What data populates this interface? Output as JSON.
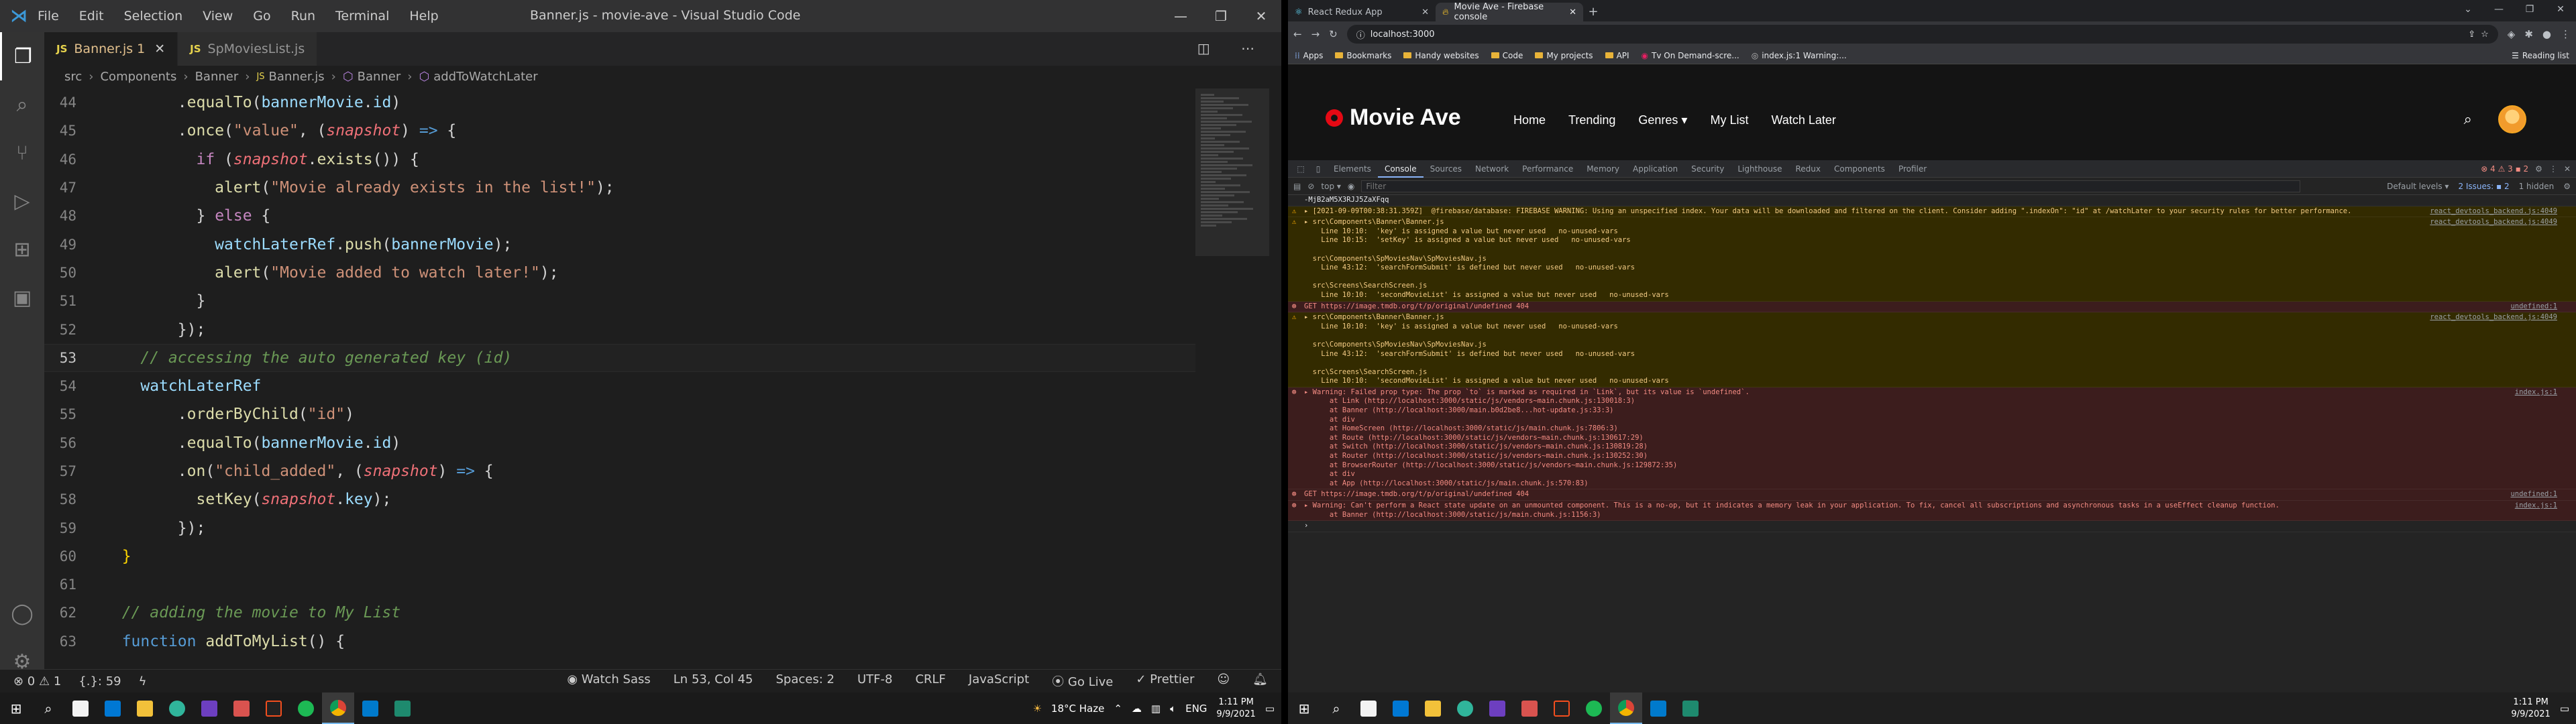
{
  "vscode": {
    "window_title": "Banner.js - movie-ave - Visual Studio Code",
    "menu": [
      "File",
      "Edit",
      "Selection",
      "View",
      "Go",
      "Run",
      "Terminal",
      "Help"
    ],
    "tabs": [
      {
        "label": "Banner.js",
        "badge": "1",
        "active": true
      },
      {
        "label": "SpMoviesList.js",
        "badge": "",
        "active": false
      }
    ],
    "breadcrumb": [
      "src",
      "Components",
      "Banner",
      "Banner.js",
      "Banner",
      "addToWatchLater"
    ],
    "code_lines": [
      {
        "n": "44",
        "html": "        <span class='tok-p'>.</span><span class='tok-fn'>equalTo</span><span class='tok-p'>(</span><span class='tok-var'>bannerMovie</span><span class='tok-p'>.</span><span class='tok-var'>id</span><span class='tok-p'>)</span>"
      },
      {
        "n": "45",
        "html": "        <span class='tok-p'>.</span><span class='tok-fn'>once</span><span class='tok-p'>(</span><span class='tok-str'>\"value\"</span><span class='tok-p'>, (</span><span class='tok-param'>snapshot</span><span class='tok-p'>) </span><span class='tok-blue'>=&gt;</span><span class='tok-p'> {</span>"
      },
      {
        "n": "46",
        "html": "          <span class='tok-kw'>if</span><span class='tok-p'> (</span><span class='tok-param'>snapshot</span><span class='tok-p'>.</span><span class='tok-fn'>exists</span><span class='tok-p'>()) {</span>"
      },
      {
        "n": "47",
        "html": "            <span class='tok-fn'>alert</span><span class='tok-p'>(</span><span class='tok-str'>\"Movie already exists in the list!\"</span><span class='tok-p'>);</span>"
      },
      {
        "n": "48",
        "html": "          <span class='tok-p'>} </span><span class='tok-kw'>else</span><span class='tok-p'> {</span>"
      },
      {
        "n": "49",
        "html": "            <span class='tok-var'>watchLaterRef</span><span class='tok-p'>.</span><span class='tok-fn'>push</span><span class='tok-p'>(</span><span class='tok-var'>bannerMovie</span><span class='tok-p'>);</span>"
      },
      {
        "n": "50",
        "html": "            <span class='tok-fn'>alert</span><span class='tok-p'>(</span><span class='tok-str'>\"Movie added to watch later!\"</span><span class='tok-p'>);</span>"
      },
      {
        "n": "51",
        "html": "          <span class='tok-p'>}</span>"
      },
      {
        "n": "52",
        "html": "        <span class='tok-p'>});</span>"
      },
      {
        "n": "53",
        "html": "    <span class='tok-cm'>// accessing the auto generated key (id)</span>",
        "current": true
      },
      {
        "n": "54",
        "html": "    <span class='tok-var'>watchLaterRef</span>"
      },
      {
        "n": "55",
        "html": "        <span class='tok-p'>.</span><span class='tok-fn'>orderByChild</span><span class='tok-p'>(</span><span class='tok-str'>\"id\"</span><span class='tok-p'>)</span>"
      },
      {
        "n": "56",
        "html": "        <span class='tok-p'>.</span><span class='tok-fn'>equalTo</span><span class='tok-p'>(</span><span class='tok-var'>bannerMovie</span><span class='tok-p'>.</span><span class='tok-var'>id</span><span class='tok-p'>)</span>"
      },
      {
        "n": "57",
        "html": "        <span class='tok-p'>.</span><span class='tok-fn'>on</span><span class='tok-p'>(</span><span class='tok-str'>\"child_added\"</span><span class='tok-p'>, (</span><span class='tok-param'>snapshot</span><span class='tok-p'>) </span><span class='tok-blue'>=&gt;</span><span class='tok-p'> {</span>"
      },
      {
        "n": "58",
        "html": "          <span class='tok-fn'>setKey</span><span class='tok-p'>(</span><span class='tok-param'>snapshot</span><span class='tok-p'>.</span><span class='tok-var'>key</span><span class='tok-p'>);</span>"
      },
      {
        "n": "59",
        "html": "        <span class='tok-p'>});</span>"
      },
      {
        "n": "60",
        "html": "  <span class='tok-yellow'>}</span>"
      },
      {
        "n": "61",
        "html": ""
      },
      {
        "n": "62",
        "html": "  <span class='tok-cm'>// adding the movie to My List</span>"
      },
      {
        "n": "63",
        "html": "  <span class='tok-blue'>function</span><span class='tok-p'> </span><span class='tok-fn'>addToMyList</span><span class='tok-p'>() {</span>"
      }
    ],
    "status": {
      "problems": "⊗ 0 ⚠ 1",
      "cursor_info": "{.}: 59",
      "watch_sass": "Watch Sass",
      "position": "Ln 53, Col 45",
      "spaces": "Spaces: 2",
      "encoding": "UTF-8",
      "eol": "CRLF",
      "language": "JavaScript",
      "go_live": "Go Live",
      "prettier": "Prettier"
    }
  },
  "chrome": {
    "tabs": [
      {
        "label": "React Redux App",
        "active": false
      },
      {
        "label": "Movie Ave - Firebase console",
        "active": true
      }
    ],
    "url": "localhost:3000",
    "bookmarks": [
      "Apps",
      "Bookmarks",
      "Handy websites",
      "Code",
      "My projects",
      "API",
      "Tv On Demand-scre...",
      "index.js:1 Warning:..."
    ],
    "reading_list": "Reading list"
  },
  "app": {
    "logo_text": "Movie Ave",
    "nav_links": [
      "Home",
      "Trending",
      "Genres ▾",
      "My List",
      "Watch Later"
    ]
  },
  "devtools": {
    "tabs": [
      "Elements",
      "Console",
      "Sources",
      "Network",
      "Performance",
      "Memory",
      "Application",
      "Security",
      "Lighthouse",
      "Redux",
      "Components",
      "Profiler"
    ],
    "active_tab": "Console",
    "counts": "⊗ 4 ⚠ 3 ▪ 2",
    "context": "top ▾",
    "filter_placeholder": "Filter",
    "default_levels": "Default levels ▾",
    "issues": "2 Issues: ▪ 2",
    "hidden": "1 hidden"
  },
  "console_messages": [
    {
      "type": "plain",
      "text": "-MjB2aM5X3RJJ5ZaXFqq",
      "src": ""
    },
    {
      "type": "warn",
      "text": "▸ [2021-09-09T00:38:31.359Z]  @firebase/database: FIREBASE WARNING: Using an unspecified index. Your data will be downloaded and filtered on the client. Consider adding \".indexOn\": \"id\" at /watchLater to your security rules for better performance.",
      "src": "react_devtools_backend.js:4049"
    },
    {
      "type": "warn",
      "text": "▸ src\\Components\\Banner\\Banner.js\n    Line 10:10:  'key' is assigned a value but never used   no-unused-vars\n    Line 10:15:  'setKey' is assigned a value but never used   no-unused-vars\n\n  src\\Components\\SpMoviesNav\\SpMoviesNav.js\n    Line 43:12:  'searchFormSubmit' is defined but never used   no-unused-vars\n\n  src\\Screens\\SearchScreen.js\n    Line 10:10:  'secondMovieList' is assigned a value but never used   no-unused-vars",
      "src": "react_devtools_backend.js:4049"
    },
    {
      "type": "err",
      "text": "GET https://image.tmdb.org/t/p/original/undefined 404",
      "src": "undefined:1"
    },
    {
      "type": "warn",
      "text": "▸ src\\Components\\Banner\\Banner.js\n    Line 10:10:  'key' is assigned a value but never used   no-unused-vars\n\n  src\\Components\\SpMoviesNav\\SpMoviesNav.js\n    Line 43:12:  'searchFormSubmit' is defined but never used   no-unused-vars\n\n  src\\Screens\\SearchScreen.js\n    Line 10:10:  'secondMovieList' is assigned a value but never used   no-unused-vars",
      "src": "react_devtools_backend.js:4049"
    },
    {
      "type": "err",
      "text": "▸ Warning: Failed prop type: The prop `to` is marked as required in `Link`, but its value is `undefined`.\n      at Link (http://localhost:3000/static/js/vendors~main.chunk.js:130018:3)\n      at Banner (http://localhost:3000/main.b0d2be8...hot-update.js:33:3)\n      at div\n      at HomeScreen (http://localhost:3000/static/js/main.chunk.js:7806:3)\n      at Route (http://localhost:3000/static/js/vendors~main.chunk.js:130617:29)\n      at Switch (http://localhost:3000/static/js/vendors~main.chunk.js:130819:28)\n      at Router (http://localhost:3000/static/js/vendors~main.chunk.js:130252:30)\n      at BrowserRouter (http://localhost:3000/static/js/vendors~main.chunk.js:129872:35)\n      at div\n      at App (http://localhost:3000/static/js/main.chunk.js:570:83)",
      "src": "index.js:1"
    },
    {
      "type": "err",
      "text": "GET https://image.tmdb.org/t/p/original/undefined 404",
      "src": "undefined:1"
    },
    {
      "type": "err",
      "text": "▸ Warning: Can't perform a React state update on an unmounted component. This is a no-op, but it indicates a memory leak in your application. To fix, cancel all subscriptions and asynchronous tasks in a useEffect cleanup function.\n      at Banner (http://localhost:3000/static/js/main.chunk.js:1156:3)",
      "src": "index.js:1"
    },
    {
      "type": "plain",
      "text": "›",
      "src": ""
    }
  ],
  "taskbar_left": {
    "weather": "18°C  Haze",
    "lang": "ENG",
    "time": "1:11 PM",
    "date": "9/9/2021"
  },
  "taskbar_right": {
    "time": "1:11 PM",
    "date": "9/9/2021"
  },
  "colors": {
    "vscode_bg": "#1e1e1e",
    "accent_blue": "#007acc",
    "app_brand_red": "#e50914",
    "warn_bg": "#332b00",
    "error_bg": "#3c1d1d"
  }
}
